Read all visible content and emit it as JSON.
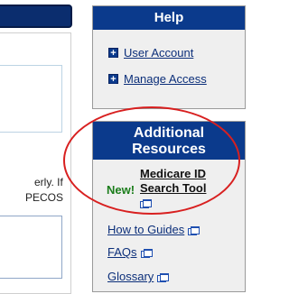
{
  "left_panel": {
    "text_line_1": "erly. If",
    "text_line_2": "PECOS"
  },
  "help": {
    "title": "Help",
    "links": [
      {
        "label": "User Account",
        "icon": "plus-box-icon"
      },
      {
        "label": "Manage Access",
        "icon": "plus-box-icon"
      }
    ]
  },
  "resources": {
    "title_line_1": "Additional",
    "title_line_2": "Resources",
    "new_badge": "New!",
    "medicare_tool_line_1": "Medicare ID",
    "medicare_tool_line_2": "Search Tool",
    "links": [
      {
        "label": "How to Guides"
      },
      {
        "label": "FAQs"
      },
      {
        "label": "Glossary"
      }
    ]
  },
  "colors": {
    "header_blue": "#0b3a8c",
    "link_blue": "#0c2f7a",
    "new_green": "#1b7d1b",
    "annotation_red": "#d82020"
  }
}
